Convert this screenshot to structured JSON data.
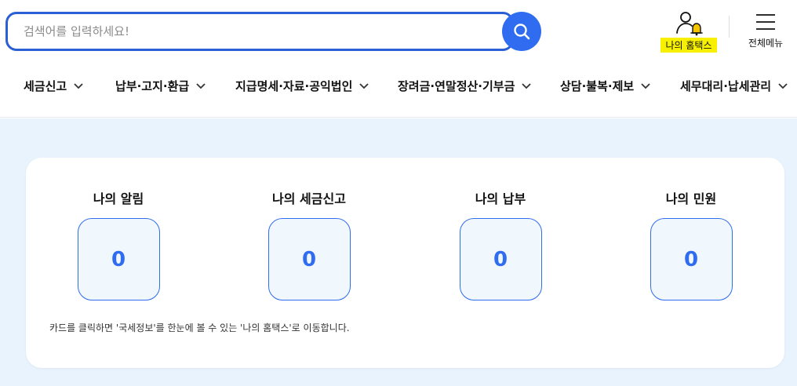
{
  "search": {
    "placeholder": "검색어를 입력하세요!"
  },
  "header": {
    "my_hometax_label": "나의 홈택스",
    "all_menu_label": "전체메뉴",
    "accent_color": "#2f6cf0",
    "highlight_color": "#f7f000"
  },
  "nav": {
    "items": [
      {
        "label": "세금신고"
      },
      {
        "label": "납부·고지·환급"
      },
      {
        "label": "지급명세·자료·공익법인"
      },
      {
        "label": "장려금·연말정산·기부금"
      },
      {
        "label": "상담·불복·제보"
      },
      {
        "label": "세무대리·납세관리"
      }
    ]
  },
  "summary": {
    "cards": [
      {
        "title": "나의 알림",
        "count": "0"
      },
      {
        "title": "나의 세금신고",
        "count": "0"
      },
      {
        "title": "나의 납부",
        "count": "0"
      },
      {
        "title": "나의 민원",
        "count": "0"
      }
    ],
    "note": "카드를 클릭하면 '국세정보'를 한눈에 볼 수 있는 '나의 홈택스'로 이동합니다."
  }
}
